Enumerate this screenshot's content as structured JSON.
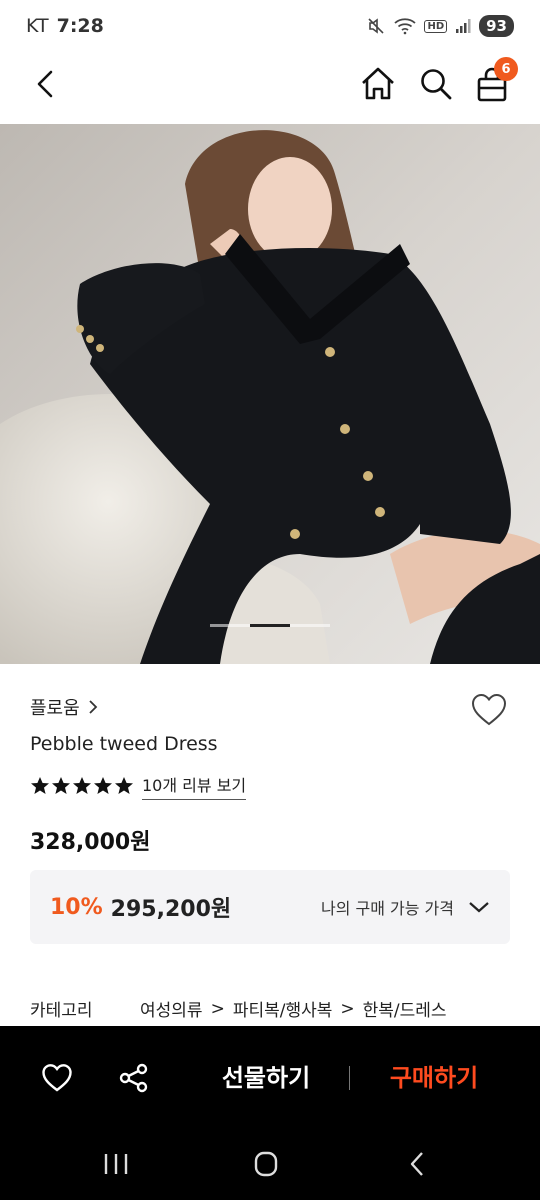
{
  "status_bar": {
    "carrier": "KT",
    "time": "7:28",
    "network": "HD",
    "battery": "93"
  },
  "app_bar": {
    "icons": [
      "back-icon",
      "home-icon",
      "search-icon",
      "cart-icon"
    ],
    "cart_count": "6"
  },
  "carousel": {
    "total": 3,
    "current": 2
  },
  "product": {
    "brand": "플로움",
    "name": "Pebble tweed Dress",
    "rating_stars": 5,
    "review_link": "10개 리뷰 보기",
    "price": "328,000원",
    "discount_rate": "10%",
    "discount_price": "295,200원",
    "price_toggle": "나의 구매 가능 가격"
  },
  "category": {
    "label": "카테고리",
    "path": [
      "여성의류",
      "파티복/행사복",
      "한복/드레스"
    ]
  },
  "actions": {
    "gift": "선물하기",
    "buy": "구매하기"
  },
  "colors": {
    "accent": "#f05a1e",
    "buy": "#ff4b1f",
    "bar_bg": "#000000"
  }
}
